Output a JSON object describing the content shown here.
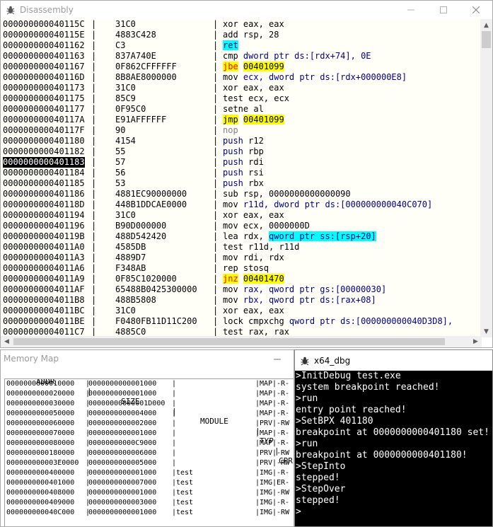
{
  "disassembly": {
    "title": "Disassembly",
    "rows": [
      {
        "addr": "000000000040115C",
        "bytes": "31C0",
        "mn": "xor",
        "ops": " eax, eax",
        "style": "plain"
      },
      {
        "addr": "000000000040115E",
        "bytes": "4883C428",
        "mn": "add",
        "ops": " rsp, 28",
        "style": "plain"
      },
      {
        "addr": "0000000000401162",
        "bytes": "C3",
        "mn": "ret",
        "ops": "",
        "style": "ret"
      },
      {
        "addr": "0000000000401163",
        "bytes": "837A740E",
        "mn": "cmp",
        "ops": " dword ptr ds:[rdx+74], 0E",
        "style": "cmp"
      },
      {
        "addr": "0000000000401167",
        "bytes": "0F862CFFFFFF",
        "mn": "jbe",
        "ops": "00401099",
        "style": "jcc"
      },
      {
        "addr": "000000000040116D",
        "bytes": "8B8AE8000000",
        "mn": "mov",
        "ops": " ecx, dword ptr ds:[rdx+000000E8]",
        "style": "memblue"
      },
      {
        "addr": "0000000000401173",
        "bytes": "31C0",
        "mn": "xor",
        "ops": " eax, eax",
        "style": "plain"
      },
      {
        "addr": "0000000000401175",
        "bytes": "85C9",
        "mn": "test",
        "ops": " ecx, ecx",
        "style": "plain"
      },
      {
        "addr": "0000000000401177",
        "bytes": "0F95C0",
        "mn": "setne",
        "ops": " al",
        "style": "plain"
      },
      {
        "addr": "000000000040117A",
        "bytes": "E91AFFFFFF",
        "mn": "jmp",
        "ops": "00401099",
        "style": "jmp"
      },
      {
        "addr": "000000000040117F",
        "bytes": "90",
        "mn": "nop",
        "ops": "",
        "style": "nop"
      },
      {
        "addr": "0000000000401180",
        "bytes": "4154",
        "mn": "push",
        "ops": " r12",
        "style": "push"
      },
      {
        "addr": "0000000000401182",
        "bytes": "55",
        "mn": "push",
        "ops": " rbp",
        "style": "push"
      },
      {
        "addr": "0000000000401183",
        "bytes": "57",
        "mn": "push",
        "ops": " rdi",
        "style": "push",
        "selected": true
      },
      {
        "addr": "0000000000401184",
        "bytes": "56",
        "mn": "push",
        "ops": " rsi",
        "style": "push"
      },
      {
        "addr": "0000000000401185",
        "bytes": "53",
        "mn": "push",
        "ops": " rbx",
        "style": "push"
      },
      {
        "addr": "0000000000401186",
        "bytes": "4881EC90000000",
        "mn": "sub",
        "ops": " rsp, 0000000000000090",
        "style": "plain"
      },
      {
        "addr": "000000000040118D",
        "bytes": "448B1DDCAE0000",
        "mn": "mov",
        "ops": " r11d, dword ptr ds:[000000000040C070]",
        "style": "memblue"
      },
      {
        "addr": "0000000000401194",
        "bytes": "31C0",
        "mn": "xor",
        "ops": " eax, eax",
        "style": "plain"
      },
      {
        "addr": "0000000000401196",
        "bytes": "B90D000000",
        "mn": "mov",
        "ops": " ecx, 0000000D",
        "style": "plain"
      },
      {
        "addr": "000000000040119B",
        "bytes": "488D542420",
        "mn": "lea",
        "ops": " rdx, ",
        "hl": "qword ptr ss:[rsp+20]",
        "style": "lea"
      },
      {
        "addr": "00000000004011A0",
        "bytes": "4585DB",
        "mn": "test",
        "ops": " r11d, r11d",
        "style": "plain"
      },
      {
        "addr": "00000000004011A3",
        "bytes": "4889D7",
        "mn": "mov",
        "ops": " rdi, rdx",
        "style": "plain"
      },
      {
        "addr": "00000000004011A6",
        "bytes": "F348AB",
        "mn": "rep stosq",
        "ops": "",
        "style": "plain"
      },
      {
        "addr": "00000000004011A9",
        "bytes": "0F85C1020000",
        "mn": "jnz",
        "ops": "00401470",
        "style": "jcc"
      },
      {
        "addr": "00000000004011AF",
        "bytes": "65488B0425300000",
        "mn": "mov",
        "ops": " rax, qword ptr gs:[00000030]",
        "style": "memblue"
      },
      {
        "addr": "00000000004011B8",
        "bytes": "488B5808",
        "mn": "mov",
        "ops": " rbx, qword ptr ds:[rax+08]",
        "style": "memblue"
      },
      {
        "addr": "00000000004011BC",
        "bytes": "31C0",
        "mn": "xor",
        "ops": " eax, eax",
        "style": "plain"
      },
      {
        "addr": "00000000004011BE",
        "bytes": "F0480FB11D11C200",
        "mn": "lock cmpxchg",
        "ops": " qword ptr ds:[000000000040D3D8],",
        "style": "memblue"
      },
      {
        "addr": "00000000004011C7",
        "bytes": "4885C0",
        "mn": "test",
        "ops": " rax, rax",
        "style": "plain"
      }
    ]
  },
  "memory_map": {
    "title": "Memory Map",
    "columns": {
      "addr": "ADDR",
      "size": "SIZE",
      "module": "MODULE",
      "type": "TYP",
      "prot": "CPR"
    },
    "header_line": "       ADDR        |       SIZE       |     MODULE      |TYP|CPR",
    "rows": [
      {
        "addr": "0000000000010000",
        "size": "0000000000001000",
        "module": "",
        "type": "MAP",
        "prot": "-R-"
      },
      {
        "addr": "0000000000020000",
        "size": "0000000000001000",
        "module": "",
        "type": "MAP",
        "prot": "-R-"
      },
      {
        "addr": "0000000000030000",
        "size": "00000000000001D000",
        "module": "",
        "type": "MAP",
        "prot": "-R-"
      },
      {
        "addr": "0000000000050000",
        "size": "0000000000004000",
        "module": "",
        "type": "MAP",
        "prot": "-R-"
      },
      {
        "addr": "0000000000060000",
        "size": "0000000000002000",
        "module": "",
        "type": "PRV",
        "prot": "-RW"
      },
      {
        "addr": "0000000000070000",
        "size": "0000000000001000",
        "module": "",
        "type": "MAP",
        "prot": "-R-"
      },
      {
        "addr": "0000000000080000",
        "size": "00000000000C9000",
        "module": "",
        "type": "MAP",
        "prot": "-R-"
      },
      {
        "addr": "0000000000180000",
        "size": "0000000000006000",
        "module": "",
        "type": "PRV",
        "prot": "-RW"
      },
      {
        "addr": "000000000003E0000",
        "size": "0000000000005000",
        "module": "",
        "type": "PRV",
        "prot": "-RW"
      },
      {
        "addr": "0000000000400000",
        "size": "0000000000001000",
        "module": "test",
        "type": "IMG",
        "prot": "-R-"
      },
      {
        "addr": "0000000000401000",
        "size": "0000000000007000",
        "module": "test",
        "type": "IMG",
        "prot": "ER-"
      },
      {
        "addr": "0000000000408000",
        "size": "0000000000001000",
        "module": "test",
        "type": "IMG",
        "prot": "-RW"
      },
      {
        "addr": "0000000000409000",
        "size": "0000000000003000",
        "module": "test",
        "type": "IMG",
        "prot": "-R-"
      },
      {
        "addr": "000000000040C000",
        "size": "0000000000001000",
        "module": "test",
        "type": "IMG",
        "prot": "-RW"
      }
    ]
  },
  "console": {
    "title": "x64_dbg",
    "lines": [
      ">InitDebug test.exe",
      "system breakpoint reached!",
      ">run",
      "entry point reached!",
      ">SetBPX 401180",
      "breakpoint at 0000000000401180 set!",
      ">run",
      "breakpoint at 0000000000401180!",
      ">StepInto",
      "stepped!",
      ">StepOver",
      "stepped!",
      ">"
    ]
  },
  "colors": {
    "disasm_bg": "#fffff8",
    "highlight_cyan": "#00ffff",
    "highlight_yellow": "#ffff00",
    "jump_red": "#ff0000",
    "keyword_blue": "#000080",
    "console_bg": "#000000"
  },
  "icons": {
    "app": "bug-icon",
    "minimize": "minimize-icon",
    "maximize": "maximize-icon",
    "close": "close-icon"
  }
}
